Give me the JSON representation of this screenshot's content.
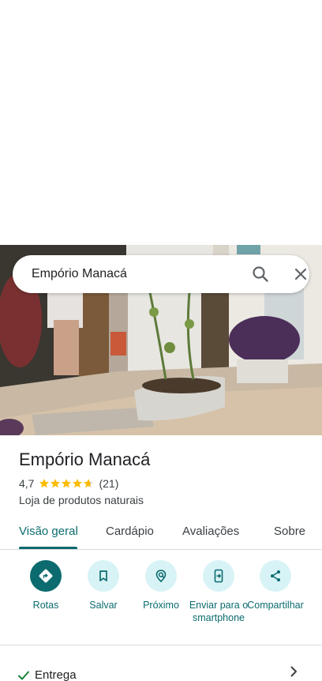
{
  "search": {
    "query": "Empório Manacá"
  },
  "place": {
    "name": "Empório Manacá",
    "rating": "4,7",
    "stars": 4.7,
    "review_count": "(21)",
    "category": "Loja de produtos naturais"
  },
  "tabs": [
    {
      "label": "Visão geral",
      "active": true
    },
    {
      "label": "Cardápio",
      "active": false
    },
    {
      "label": "Avaliações",
      "active": false
    },
    {
      "label": "Sobre",
      "active": false
    }
  ],
  "actions": [
    {
      "label": "Rotas",
      "icon": "directions-icon"
    },
    {
      "label": "Salvar",
      "icon": "bookmark-icon"
    },
    {
      "label": "Próximo",
      "icon": "nearby-icon"
    },
    {
      "label": "Enviar para o smartphone",
      "icon": "send-to-phone-icon"
    },
    {
      "label": "Compartilhar",
      "icon": "share-icon"
    }
  ],
  "delivery": {
    "label": "Entrega"
  },
  "colors": {
    "accent": "#0b6b6e",
    "action_bg": "#d8f3f6",
    "star": "#fbbc04"
  }
}
